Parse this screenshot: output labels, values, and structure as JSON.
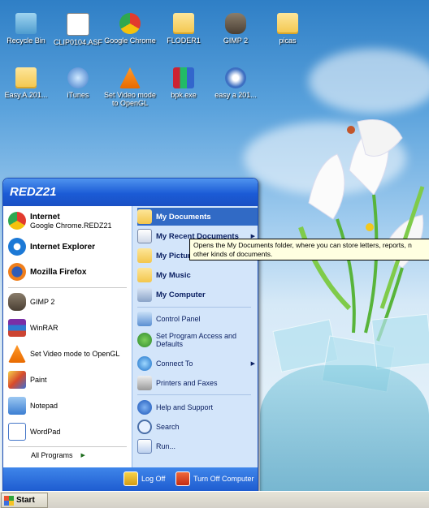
{
  "desktop": {
    "icons_row1": [
      {
        "label": "Recycle Bin",
        "icon": "recycle-bin-icon"
      },
      {
        "label": "CLIP0104.ASF",
        "icon": "media-file-icon"
      },
      {
        "label": "Google Chrome",
        "icon": "chrome-icon"
      },
      {
        "label": "FLODER1",
        "icon": "folder-icon"
      },
      {
        "label": "GIMP 2",
        "icon": "gimp-icon"
      },
      {
        "label": "picas",
        "icon": "folder-icon"
      }
    ],
    "icons_row2": [
      {
        "label": "Easy.A.201...",
        "icon": "folder-icon"
      },
      {
        "label": "iTunes",
        "icon": "itunes-icon"
      },
      {
        "label": "Set Video mode to OpenGL",
        "icon": "vlc-icon"
      },
      {
        "label": "bpk.exe",
        "icon": "exe-icon"
      },
      {
        "label": "easy a 201...",
        "icon": "media-player-icon"
      }
    ]
  },
  "start_menu": {
    "user_name": "REDZ21",
    "pinned": [
      {
        "title": "Internet",
        "subtitle": "Google Chrome.REDZ21",
        "icon": "chrome-icon"
      },
      {
        "title": "Internet Explorer",
        "subtitle": "",
        "icon": "ie-icon"
      },
      {
        "title": "Mozilla Firefox",
        "subtitle": "",
        "icon": "firefox-icon"
      }
    ],
    "recent": [
      {
        "label": "GIMP 2",
        "icon": "gimp-icon"
      },
      {
        "label": "WinRAR",
        "icon": "winrar-icon"
      },
      {
        "label": "Set Video mode to OpenGL",
        "icon": "vlc-icon"
      },
      {
        "label": "Paint",
        "icon": "paint-icon"
      },
      {
        "label": "Notepad",
        "icon": "notepad-icon"
      },
      {
        "label": "WordPad",
        "icon": "wordpad-icon"
      }
    ],
    "all_programs": "All Programs",
    "places": [
      {
        "label": "My Documents",
        "icon": "my-documents-icon"
      },
      {
        "label": "My Recent Documents",
        "icon": "recent-documents-icon"
      },
      {
        "label": "My Pictures",
        "icon": "my-pictures-icon"
      },
      {
        "label": "My Music",
        "icon": "my-music-icon"
      },
      {
        "label": "My Computer",
        "icon": "my-computer-icon"
      }
    ],
    "settings": [
      {
        "label": "Control Panel",
        "icon": "control-panel-icon"
      },
      {
        "label": "Set Program Access and Defaults",
        "icon": "program-access-icon"
      },
      {
        "label": "Connect To",
        "icon": "connect-to-icon"
      },
      {
        "label": "Printers and Faxes",
        "icon": "printer-icon"
      }
    ],
    "help": [
      {
        "label": "Help and Support",
        "icon": "help-icon"
      },
      {
        "label": "Search",
        "icon": "search-icon"
      },
      {
        "label": "Run...",
        "icon": "run-icon"
      }
    ],
    "log_off": "Log Off",
    "turn_off": "Turn Off Computer"
  },
  "tooltip": {
    "text": "Opens the My Documents folder, where you can store letters, reports, n other kinds of documents."
  },
  "taskbar": {
    "start_label": "Start"
  }
}
